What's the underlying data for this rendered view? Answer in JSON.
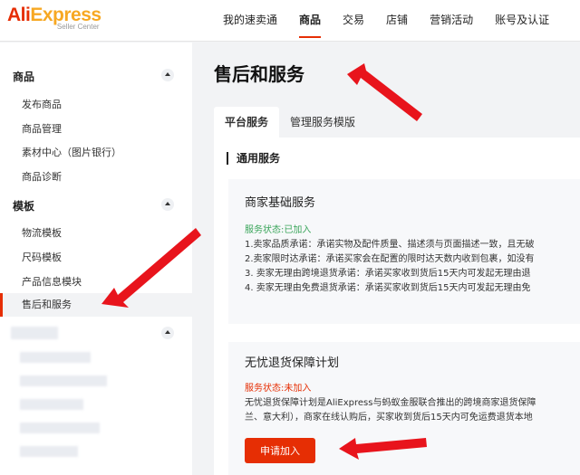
{
  "header": {
    "logo_main_ali": "Ali",
    "logo_main_express": "Express",
    "logo_sub": "Seller Center",
    "nav": [
      "我的速卖通",
      "商品",
      "交易",
      "店铺",
      "营销活动",
      "账号及认证"
    ]
  },
  "sidebar": {
    "group1_title": "商品",
    "group1_items": [
      "发布商品",
      "商品管理",
      "素材中心（图片银行）",
      "商品诊断"
    ],
    "group2_title": "模板",
    "group2_items": [
      "物流模板",
      "尺码模板",
      "产品信息模块",
      "售后和服务"
    ]
  },
  "main": {
    "title": "售后和服务",
    "tabs": [
      "平台服务",
      "管理服务模版"
    ],
    "section_title": "通用服务",
    "card1": {
      "title": "商家基础服务",
      "status": "服务状态:已加入",
      "lines": [
        "1.卖家品质承诺：承诺实物及配件质量、描述须与页面描述一致，且无破",
        "2.卖家限时达承诺：承诺买家会在配置的限时达天数内收到包裹，如没有",
        "3.  卖家无理由跨境退货承诺：承诺买家收到货后15天内可发起无理由退",
        "4.  卖家无理由免费退货承诺：承诺买家收到货后15天内可发起无理由免"
      ]
    },
    "card2": {
      "title": "无忧退货保障计划",
      "status": "服务状态:未加入",
      "lines": [
        "无忧退货保障计划是AliExpress与蚂蚁金服联合推出的跨境商家退货保障",
        "兰、意大利），商家在线认购后，买家收到货后15天内可免运费退货本地"
      ],
      "button": "申请加入"
    }
  },
  "colors": {
    "brand": "#e62e04",
    "accent": "#f7a823",
    "status_on": "#3aa55a",
    "arrow": "#e8141c"
  }
}
